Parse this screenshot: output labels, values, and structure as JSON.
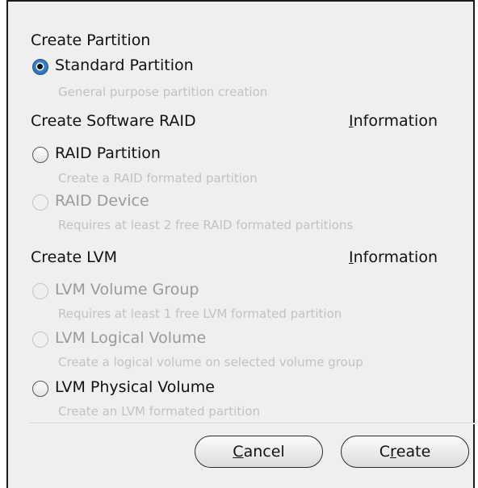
{
  "partition": {
    "heading": "Create Partition",
    "standard": {
      "label": "Standard Partition",
      "description": "General purpose partition creation",
      "selected": true
    }
  },
  "raid": {
    "heading": "Create Software RAID",
    "info_label_mnemonic": "I",
    "info_label_rest": "nformation",
    "partition": {
      "label": "RAID Partition",
      "description": "Create a RAID formated partition"
    },
    "device": {
      "label": "RAID Device",
      "description": "Requires at least 2 free RAID formated partitions"
    }
  },
  "lvm": {
    "heading": "Create LVM",
    "info_label_mnemonic": "I",
    "info_label_rest": "nformation",
    "volume_group": {
      "label": "LVM Volume Group",
      "description": "Requires at least 1 free LVM formated partition"
    },
    "logical_volume": {
      "label": "LVM Logical Volume",
      "description": "Create a logical volume on selected volume group"
    },
    "physical_volume": {
      "label": "LVM Physical Volume",
      "description": "Create an LVM formated partition"
    }
  },
  "buttons": {
    "cancel_mnemonic": "C",
    "cancel_rest": "ancel",
    "create_pre": "C",
    "create_mnemonic": "r",
    "create_rest": "eate"
  },
  "colors": {
    "background": "#efefef",
    "selected_radio": "#2f78c4",
    "disabled_text": "#9a9a9a",
    "description_text": "#c2c2c2"
  }
}
